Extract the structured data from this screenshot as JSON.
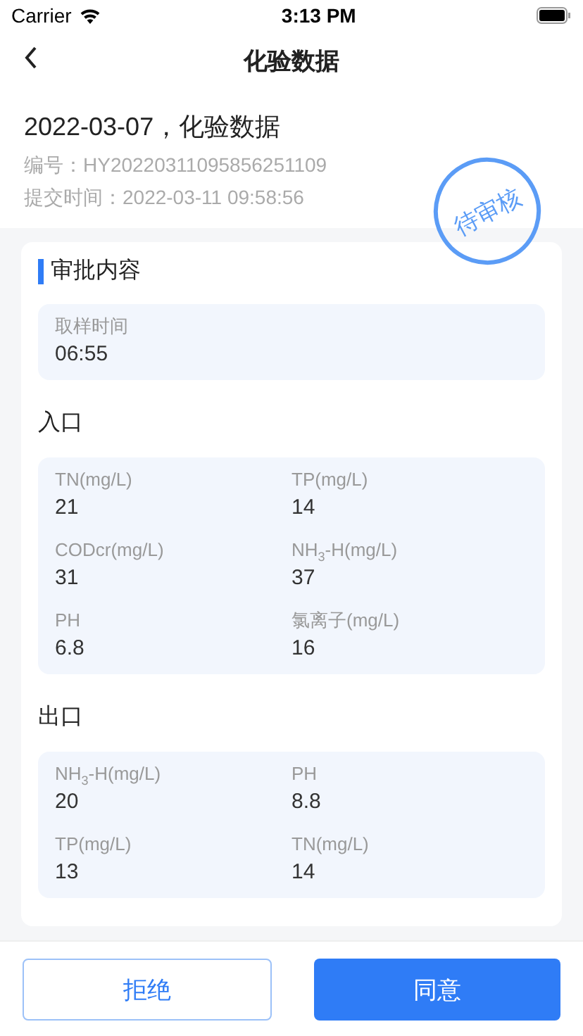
{
  "status_bar": {
    "carrier": "Carrier",
    "time": "3:13 PM"
  },
  "nav": {
    "title": "化验数据"
  },
  "header": {
    "title": "2022-03-07，化验数据",
    "number": "编号：HY20220311095856251109",
    "submit_time": "提交时间：2022-03-11 09:58:56",
    "stamp": "待审核"
  },
  "card": {
    "title": "审批内容",
    "sample": {
      "label": "取样时间",
      "value": "06:55"
    },
    "sections": [
      {
        "title": "入口",
        "items": [
          {
            "label": "TN(mg/L)",
            "value": "21"
          },
          {
            "label": "TP(mg/L)",
            "value": "14"
          },
          {
            "label": "CODcr(mg/L)",
            "value": "31"
          },
          {
            "label": "NH$_{3}$-H(mg/L)",
            "value": "37"
          },
          {
            "label": "PH",
            "value": "6.8"
          },
          {
            "label": "氯离子(mg/L)",
            "value": "16"
          }
        ]
      },
      {
        "title": "出口",
        "items": [
          {
            "label": "NH$_{3}$-H(mg/L)",
            "value": "20"
          },
          {
            "label": "PH",
            "value": "8.8"
          },
          {
            "label": "TP(mg/L)",
            "value": "13"
          },
          {
            "label": "TN(mg/L)",
            "value": "14"
          }
        ]
      }
    ]
  },
  "buttons": [
    {
      "label": "拒绝",
      "kind": "outline"
    },
    {
      "label": "同意",
      "kind": "primary"
    }
  ]
}
